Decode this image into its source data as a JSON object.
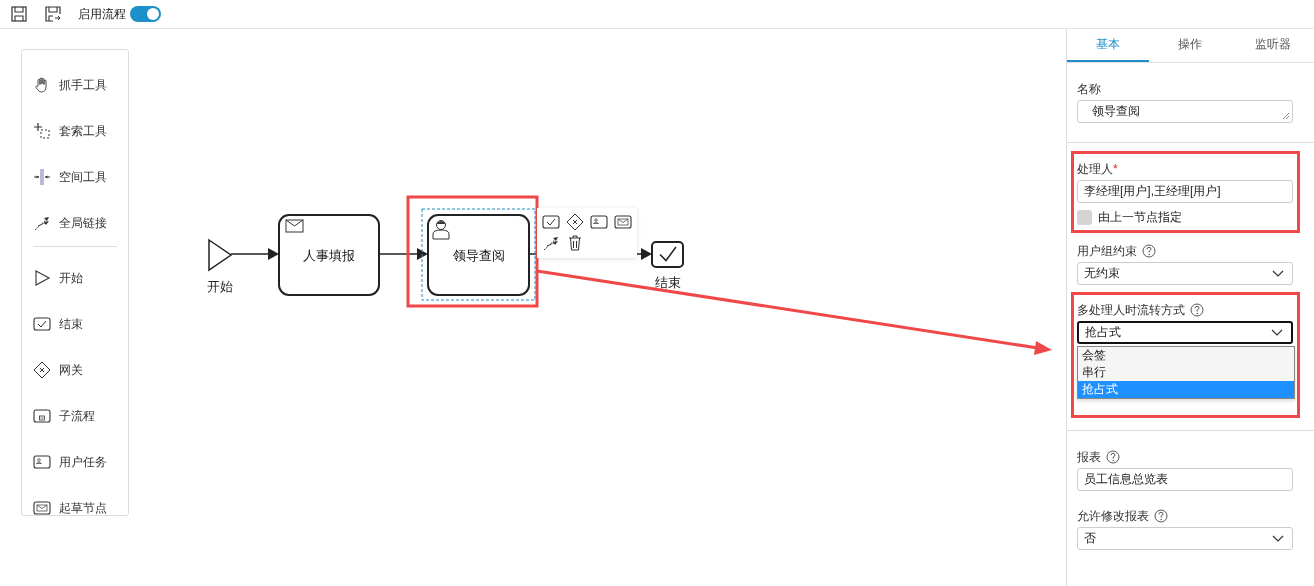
{
  "toolbar": {
    "buttons": [
      {
        "kind": "save"
      },
      {
        "kind": "save-as"
      }
    ],
    "toggle": {
      "label": "启用流程",
      "on": true
    }
  },
  "palette": {
    "groups": [
      {
        "items": [
          {
            "kind": "hand",
            "label": "抓手工具"
          },
          {
            "kind": "lasso",
            "label": "套索工具"
          },
          {
            "kind": "space",
            "label": "空间工具"
          },
          {
            "kind": "connect",
            "label": "全局链接"
          }
        ]
      },
      {
        "items": [
          {
            "kind": "start",
            "label": "开始"
          },
          {
            "kind": "end",
            "label": "结束"
          },
          {
            "kind": "gateway",
            "label": "网关"
          },
          {
            "kind": "subprocess",
            "label": "子流程"
          },
          {
            "kind": "usertask",
            "label": "用户任务"
          },
          {
            "kind": "draft",
            "label": "起草节点"
          }
        ]
      }
    ]
  },
  "nodes": [
    {
      "kind": "start",
      "label": "开始",
      "selected": false,
      "highlighted": false
    },
    {
      "kind": "draft",
      "label": "人事填报",
      "selected": false,
      "highlighted": false
    },
    {
      "kind": "usertask",
      "label": "领导查阅",
      "selected": true,
      "highlighted": true
    },
    {
      "kind": "end",
      "label": "结束",
      "selected": false,
      "highlighted": false
    }
  ],
  "context_pad": [
    {
      "kind": "end"
    },
    {
      "kind": "gateway"
    },
    {
      "kind": "usertask"
    },
    {
      "kind": "draft"
    },
    {
      "kind": "connect"
    },
    {
      "kind": "delete"
    }
  ],
  "panel": {
    "tabs": [
      {
        "label": "基本",
        "selected": true
      },
      {
        "label": "操作",
        "selected": false
      },
      {
        "label": "监听器",
        "selected": false
      }
    ],
    "sections": [
      {
        "fields": [
          {
            "kind": "textarea",
            "label": "名称",
            "value": "领导查阅",
            "help": false,
            "highlighted": false
          }
        ]
      },
      {
        "fields": [
          {
            "kind": "input",
            "label": "处理人",
            "required_mark": "*",
            "value": "李经理[用户],王经理[用户]",
            "help": false,
            "highlighted": true,
            "checkbox": {
              "label": "由上一节点指定",
              "checked": false
            }
          },
          {
            "kind": "select",
            "label": "用户组约束",
            "value": "无约束",
            "help": true,
            "highlighted": false
          },
          {
            "kind": "select",
            "label": "多处理人时流转方式",
            "value": "抢占式",
            "help": true,
            "highlighted": true,
            "expanded": true,
            "options": [
              {
                "label": "会签",
                "selected": false
              },
              {
                "label": "串行",
                "selected": false
              },
              {
                "label": "抢占式",
                "selected": true
              }
            ]
          }
        ]
      },
      {
        "fields": [
          {
            "kind": "input",
            "label": "报表",
            "value": "员工信息总览表",
            "help": true,
            "highlighted": false
          },
          {
            "kind": "select",
            "label": "允许修改报表",
            "value": "否",
            "help": true,
            "highlighted": false
          }
        ]
      }
    ]
  }
}
